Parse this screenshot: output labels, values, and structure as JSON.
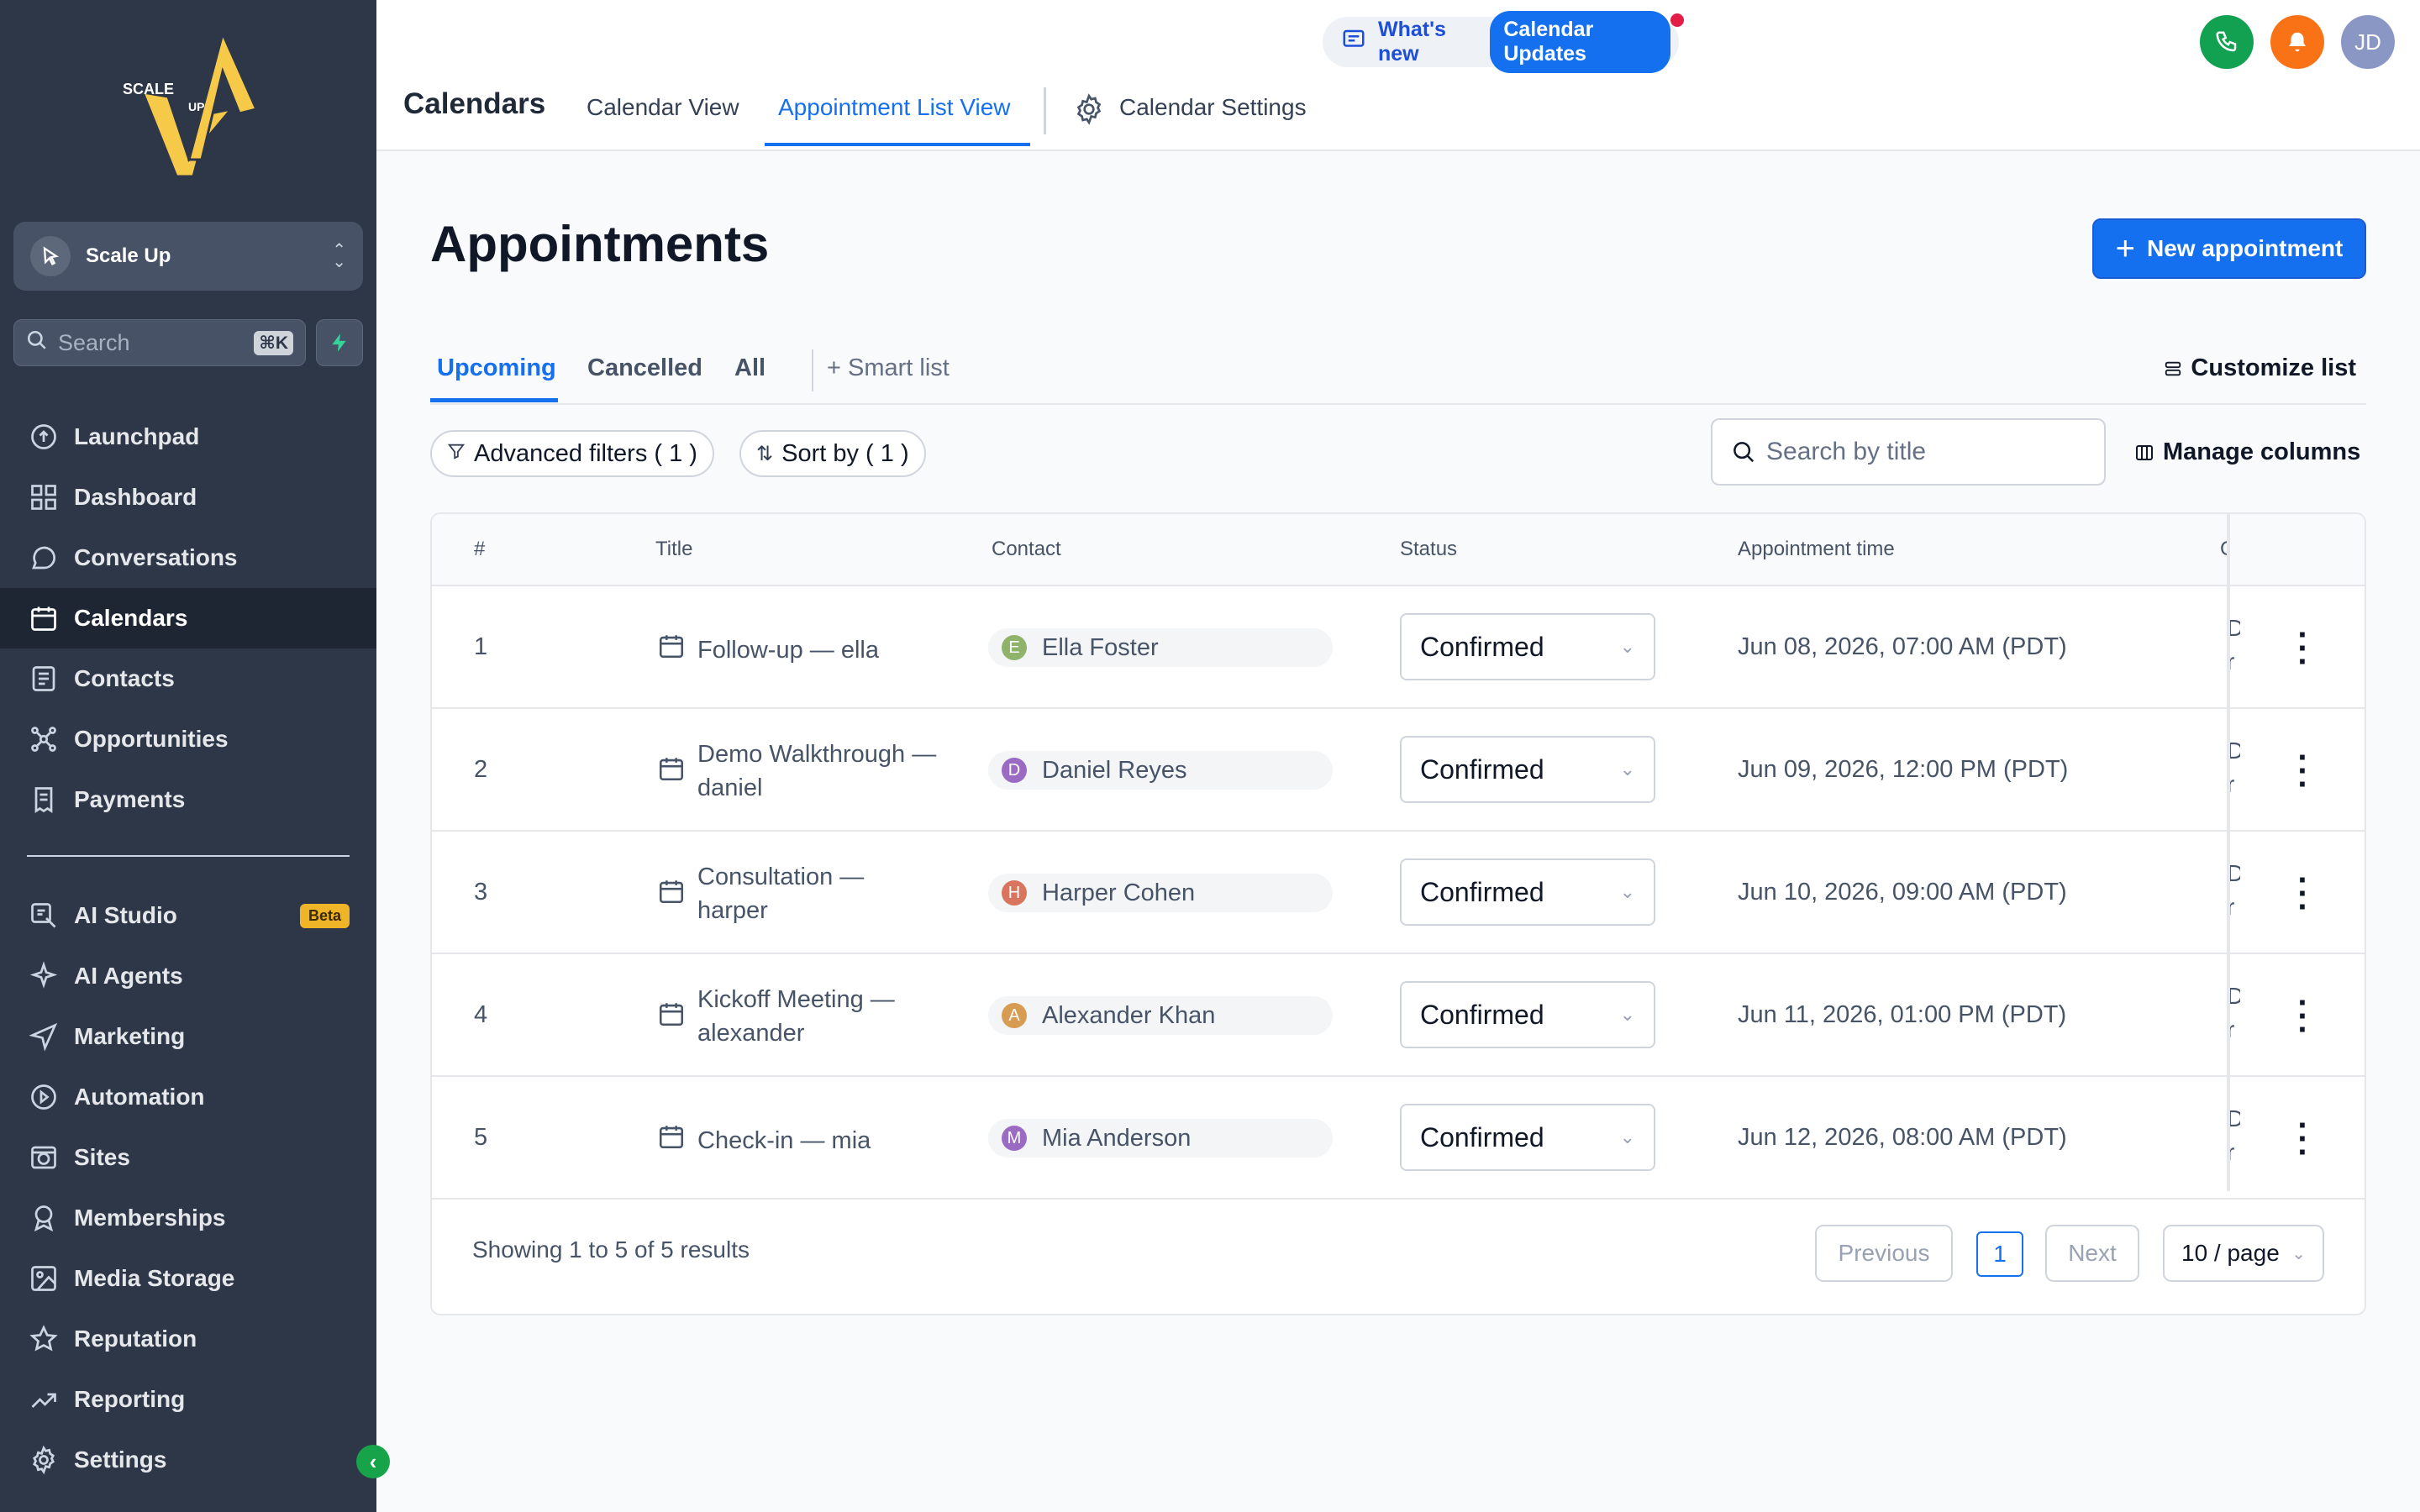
{
  "brand": {
    "logo_text_top": "SCALE",
    "logo_text_mid": "UP"
  },
  "account": {
    "name": "Scale Up"
  },
  "sidebar_search": {
    "placeholder": "Search",
    "shortcut": "⌘K"
  },
  "nav_top": [
    {
      "label": "Launchpad",
      "icon": "rocket-icon"
    },
    {
      "label": "Dashboard",
      "icon": "grid-icon"
    },
    {
      "label": "Conversations",
      "icon": "chat-icon"
    },
    {
      "label": "Calendars",
      "icon": "calendar-icon",
      "active": true
    },
    {
      "label": "Contacts",
      "icon": "contact-card-icon"
    },
    {
      "label": "Opportunities",
      "icon": "network-icon"
    },
    {
      "label": "Payments",
      "icon": "receipt-icon"
    }
  ],
  "nav_bottom": [
    {
      "label": "AI Studio",
      "icon": "ai-studio-icon",
      "badge": "Beta"
    },
    {
      "label": "AI Agents",
      "icon": "sparkle-icon"
    },
    {
      "label": "Marketing",
      "icon": "send-icon"
    },
    {
      "label": "Automation",
      "icon": "automation-icon"
    },
    {
      "label": "Sites",
      "icon": "sites-icon"
    },
    {
      "label": "Memberships",
      "icon": "award-icon"
    },
    {
      "label": "Media Storage",
      "icon": "image-icon"
    },
    {
      "label": "Reputation",
      "icon": "star-icon"
    },
    {
      "label": "Reporting",
      "icon": "trend-icon"
    },
    {
      "label": "Settings",
      "icon": "gear-icon"
    }
  ],
  "topbar": {
    "heading": "Calendars",
    "tabs": [
      "Calendar View",
      "Appointment List View"
    ],
    "settings_tab": "Calendar Settings",
    "whats_new": "What's new",
    "updates_pill": "Calendar Updates",
    "user_initials": "JD"
  },
  "main": {
    "title": "Appointments",
    "new_button": "New appointment",
    "subtabs": [
      "Upcoming",
      "Cancelled",
      "All"
    ],
    "smart_list": "+ Smart list",
    "customize": "Customize list",
    "advanced_filters": "Advanced filters ( 1 )",
    "sort_by": "Sort by ( 1 )",
    "search_placeholder": "Search by title",
    "manage_columns": "Manage columns"
  },
  "table": {
    "headers": [
      "#",
      "Title",
      "Contact",
      "Status",
      "Appointment time",
      "C"
    ],
    "rows": [
      {
        "num": "1",
        "title": "Follow-up — ella",
        "contact": "Ella Foster",
        "initial": "E",
        "avatar_color": "#8fb36a",
        "status": "Confirmed",
        "time": "Jun 08, 2026, 07:00 AM (PDT)",
        "trunc1": "D",
        "trunc2": "r"
      },
      {
        "num": "2",
        "title": "Demo Walkthrough — daniel",
        "contact": "Daniel Reyes",
        "initial": "D",
        "avatar_color": "#9b6bc4",
        "status": "Confirmed",
        "time": "Jun 09, 2026, 12:00 PM (PDT)",
        "trunc1": "D",
        "trunc2": "r"
      },
      {
        "num": "3",
        "title": "Consultation — harper",
        "contact": "Harper Cohen",
        "initial": "H",
        "avatar_color": "#d9745e",
        "status": "Confirmed",
        "time": "Jun 10, 2026, 09:00 AM (PDT)",
        "trunc1": "D",
        "trunc2": "r"
      },
      {
        "num": "4",
        "title": "Kickoff Meeting — alexander",
        "contact": "Alexander Khan",
        "initial": "A",
        "avatar_color": "#d79b52",
        "status": "Confirmed",
        "time": "Jun 11, 2026, 01:00 PM (PDT)",
        "trunc1": "D",
        "trunc2": "r"
      },
      {
        "num": "5",
        "title": "Check-in — mia",
        "contact": "Mia Anderson",
        "initial": "M",
        "avatar_color": "#9b6bc4",
        "status": "Confirmed",
        "time": "Jun 12, 2026, 08:00 AM (PDT)",
        "trunc1": "D",
        "trunc2": "r"
      }
    ]
  },
  "pagination": {
    "summary": "Showing 1 to 5 of 5 results",
    "previous": "Previous",
    "current": "1",
    "next": "Next",
    "page_size": "10 / page"
  },
  "colors": {
    "accent": "#1570ef",
    "sidebar": "#2d3748",
    "phone": "#12a150",
    "bell": "#f97316",
    "avatar": "#8a96c4"
  }
}
